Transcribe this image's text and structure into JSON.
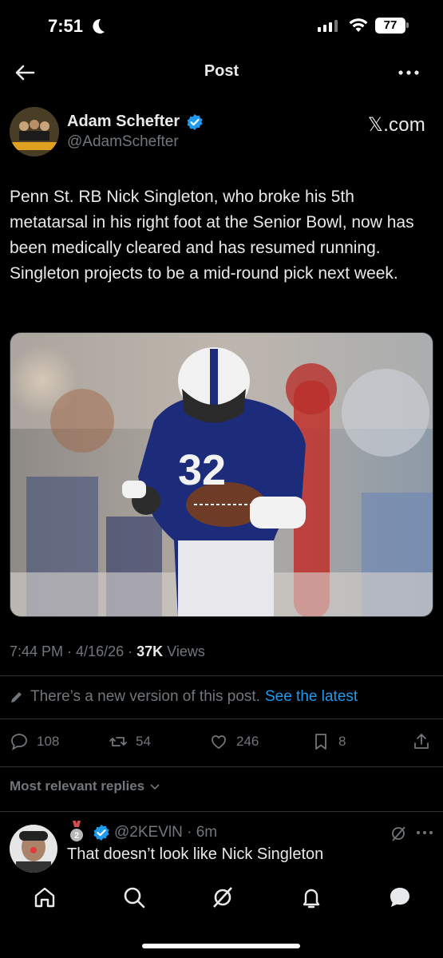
{
  "status_bar": {
    "time": "7:51",
    "battery": "77"
  },
  "header": {
    "title": "Post"
  },
  "tweet": {
    "author_name": "Adam Schefter",
    "handle": "@AdamSchefter",
    "source": "𝕏.com",
    "text": "Penn St. RB Nick Singleton, who broke his 5th metatarsal in his right foot at the Senior Bowl, now has been medically cleared and has resumed running. Singleton projects to be a mid-round pick next week.",
    "photo_icon": "football-player-photo",
    "time": "7:44 PM",
    "date": "4/16/26",
    "views_count": "37K",
    "views_label": "Views"
  },
  "new_version": {
    "text": "There’s a new version of this post.",
    "link": "See the latest"
  },
  "actions": {
    "replies": "108",
    "reposts": "54",
    "likes": "246",
    "bookmarks": "8"
  },
  "replies_sort": {
    "label": "Most relevant replies"
  },
  "reply": {
    "medal_number": "2",
    "handle": "@2KEVlN",
    "time": "6m",
    "text": "That doesn’t look like Nick Singleton"
  },
  "colors": {
    "accent": "#1d9bf0",
    "muted": "#71767b",
    "text": "#e7e9ea",
    "background": "#000000"
  }
}
